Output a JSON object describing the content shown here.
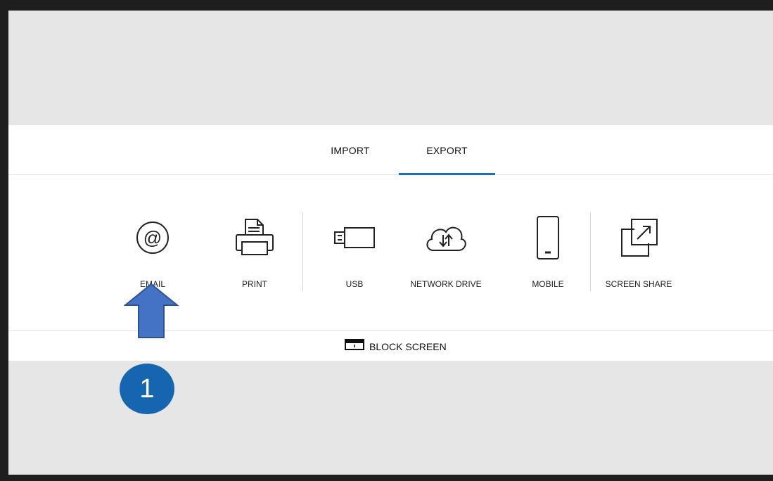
{
  "tabs": {
    "import_label": "IMPORT",
    "export_label": "EXPORT",
    "active": "EXPORT"
  },
  "options": {
    "email": "EMAIL",
    "print": "PRINT",
    "usb": "USB",
    "network_drive": "NETWORK DRIVE",
    "mobile": "MOBILE",
    "screen_share": "SCREEN SHARE"
  },
  "bottom": {
    "block_screen_label": "BLOCK SCREEN"
  },
  "annotation": {
    "step_number": "1"
  },
  "colors": {
    "accent": "#1f6fb8",
    "arrow": "#4472c4",
    "badge": "#1565b0"
  }
}
